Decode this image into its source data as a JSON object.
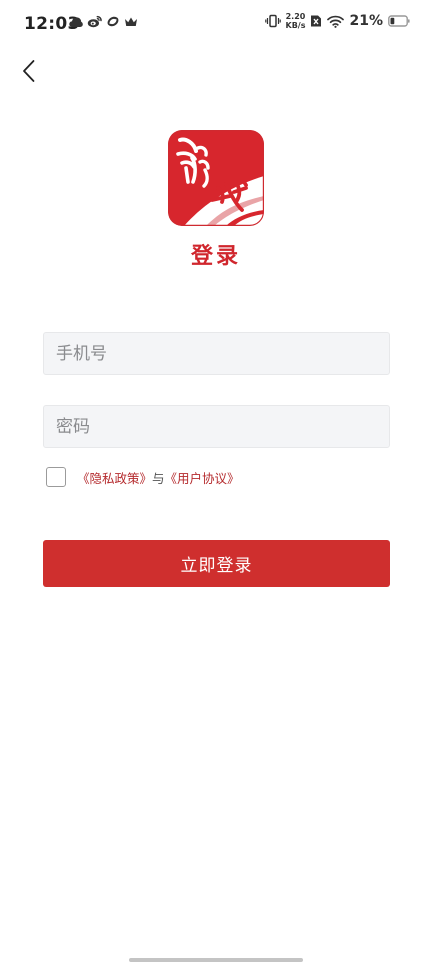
{
  "status_bar": {
    "time": "12:03",
    "net_speed_value": "2.20",
    "net_speed_unit": "KB/s",
    "battery": "21%",
    "notification_icons": [
      "cloud-icon",
      "weibo-icon",
      "sync-app-icon",
      "crown-icon"
    ],
    "system_icons": [
      "vibrate-icon",
      "net-speed-indicator",
      "no-sim-icon",
      "wifi-icon",
      "battery-icon"
    ]
  },
  "header": {
    "back_icon": "chevron-left-icon"
  },
  "logo": {
    "icon": "app-logo",
    "brand_color": "#d0262d"
  },
  "title": "登录",
  "form": {
    "phone_placeholder": "手机号",
    "phone_value": "",
    "password_placeholder": "密码",
    "password_value": ""
  },
  "agreement": {
    "checked": false,
    "privacy_link": "《隐私政策》",
    "conjunction": "与",
    "user_agreement_link": "《用户协议》"
  },
  "login_button": {
    "label": "立即登录",
    "color": "#cf2f2e"
  },
  "colors": {
    "accent": "#d0262d",
    "field_background": "#f4f5f7",
    "placeholder": "#8a8b8e"
  }
}
